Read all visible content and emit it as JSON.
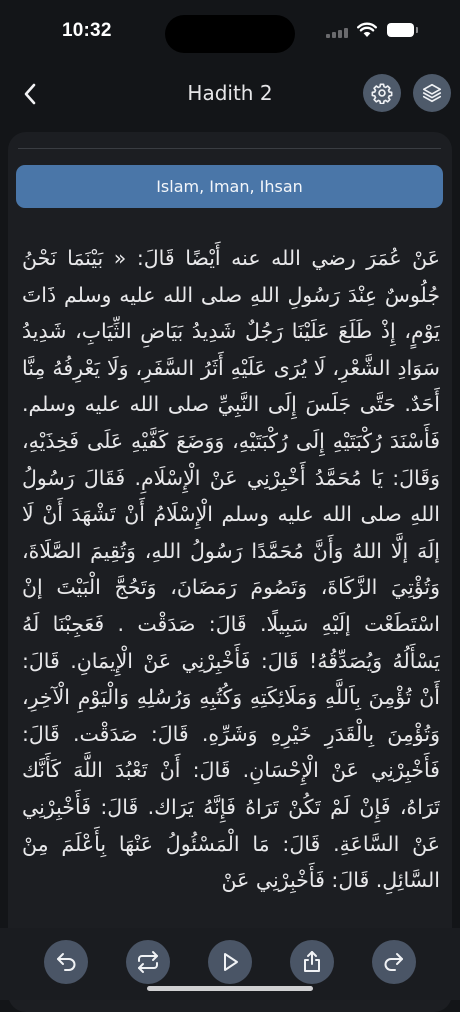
{
  "status_bar": {
    "time": "10:32"
  },
  "header": {
    "title": "Hadith 2",
    "back_icon": "chevron-left-icon",
    "settings_icon": "gear-icon",
    "layers_icon": "layers-icon"
  },
  "topic": "Islam, Iman, Ihsan",
  "hadith_text": "عَنْ عُمَرَ رضي الله عنه أَيْضًا قَالَ: « بَيْنَمَا نَحْنُ جُلُوسٌ عِنْدَ رَسُولِ اللهِ صلى الله عليه وسلم ذَاتَ يَوْمٍ، إِذْ طَلَعَ عَلَيْنَا رَجُلٌ شَدِيدُ بَيَاضِ الثِّيَابِ، شَدِيدُ سَوَادِ الشَّعْرِ، لَا يُرَى عَلَيْهِ أَثَرُ السَّفَرِ، وَلَا يَعْرِفُهُ مِنَّا أَحَدٌ. حَتَّى جَلَسَ إِلَى النَّبِيِّ صلى الله عليه وسلم. فَأَسْنَدَ رُكْبَتَيْهِ إِلَى رُكْبَتَيْهِ، وَوَضَعَ كَفَّيْهِ عَلَى فَخِذَيْهِ، وَقَالَ: يَا مُحَمَّدُ أَخْبِرْنِي عَنْ الْإِسْلَامِ. فَقَالَ رَسُولُ اللهِ صلى الله عليه وسلم الْإِسْلَامُ أَنْ تَشْهَدَ أَنْ لَا إلَهَ إلَّا اللهُ وَأَنَّ مُحَمَّدًا رَسُولُ اللهِ، وَتُقِيمَ الصَّلَاةَ، وَتُؤْتِيَ الزَّكَاةَ، وَتَصُومَ رَمَضَانَ، وَتَحُجَّ الْبَيْتَ إنْ اسْتَطَعْت إلَيْهِ سَبِيلًا. قَالَ: صَدَقْت . فَعَجِبْنَا لَهُ يَسْأَلُهُ وَيُصَدِّقُهُ! قَالَ: فَأَخْبِرْنِي عَنْ الْإِيمَانِ. قَالَ: أَنْ تُؤْمِنَ بِاَللَّهِ وَمَلَائِكَتِهِ وَكُتُبِهِ وَرُسُلِهِ وَالْيَوْمِ الْآخِرِ، وَتُؤْمِنَ بِالْقَدَرِ خَيْرِهِ وَشَرِّهِ. قَالَ: صَدَقْت. قَالَ: فَأَخْبِرْنِي عَنْ الْإِحْسَانِ. قَالَ: أَنْ تَعْبُدَ اللَّهَ كَأَنَّك تَرَاهُ، فَإِنْ لَمْ تَكُنْ تَرَاهُ فَإِنَّهُ يَرَاك. قَالَ: فَأَخْبِرْنِي عَنْ السَّاعَةِ. قَالَ: مَا الْمَسْئُولُ عَنْهَا بِأَعْلَمَ مِنْ السَّائِلِ. قَالَ: فَأَخْبِرْنِي عَنْ",
  "bottom_bar": {
    "buttons": [
      {
        "icon": "undo-arrow-icon"
      },
      {
        "icon": "repeat-icon"
      },
      {
        "icon": "play-icon"
      },
      {
        "icon": "share-icon"
      },
      {
        "icon": "redo-arrow-icon"
      }
    ]
  },
  "colors": {
    "background": "#131518",
    "card": "#1c1e22",
    "accent": "#4a76a8",
    "button": "#4e5a6a"
  }
}
